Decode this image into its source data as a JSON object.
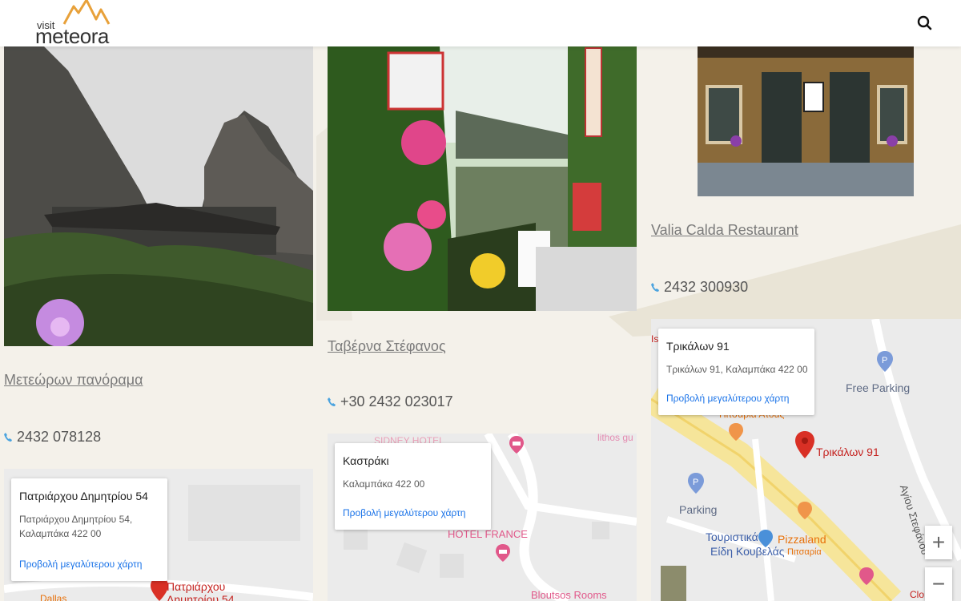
{
  "header": {
    "logo_small": "visit",
    "logo_name": "meteora",
    "search_icon": "search-icon"
  },
  "cards": [
    {
      "title": "Μετεώρων πανόραμα",
      "phone": "2432 078128",
      "map": {
        "info_title": "Πατριάρχου Δημητρίου 54",
        "info_addr_line1": "Πατριάρχου Δημητρίου 54,",
        "info_addr_line2": "Καλαμπάκα 422 00",
        "info_link": "Προβολή μεγαλύτερου χάρτη",
        "pin_label_line1": "Πατριάρχου",
        "pin_label_line2": "Δημητρίου 54",
        "poi_partial": "Dallas"
      }
    },
    {
      "title": "Ταβέρνα Στέφανος",
      "phone": "+30 2432 023017",
      "map": {
        "info_title": "Καστράκι",
        "info_addr": "Καλαμπάκα 422 00",
        "info_link": "Προβολή μεγαλύτερου χάρτη",
        "poi_hotel_france": "HOTEL FRANCE",
        "poi_sidney": "SIDNEY HOTEL",
        "poi_lithos": "lithos gu",
        "poi_bloutsos": "Bloutsos Rooms"
      }
    },
    {
      "title": "Valia Calda Restaurant",
      "phone": "2432 300930",
      "map": {
        "info_title": "Τρικάλων 91",
        "info_addr": "Τρικάλων 91, Καλαμπάκα 422 00",
        "info_link": "Προβολή μεγαλύτερου χάρτη",
        "pin_label": "Τρικάλων 91",
        "poi_free_parking": "Free Parking",
        "poi_parking": "Parking",
        "poi_pizzaland": "Pizzaland",
        "poi_pizzaland_sub": "Πιτσαρία",
        "poi_touristika_1": "Τουριστικά",
        "poi_touristika_2": "Είδη Κουβελάς",
        "poi_pitsaria_atoas": "Πιτσαρία Ατοας",
        "street_agiou": "Αγίου Στεφάνου",
        "edge_left": "Is",
        "edge_clo": "Clo",
        "zoom_in": "+",
        "zoom_out": "−"
      }
    }
  ],
  "colors": {
    "accent_orange": "#e8a13a",
    "link_blue": "#1a73e8",
    "pin_red": "#d93025",
    "phone_icon": "#4aa3df"
  }
}
